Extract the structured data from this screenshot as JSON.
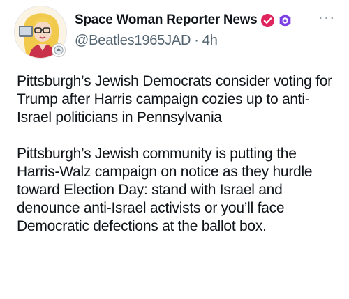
{
  "post": {
    "author": {
      "display_name": "Space Woman Reporter News",
      "handle": "@Beatles1965JAD",
      "avatar_icon": "avatar-cartoon-reporter",
      "verified_icon": "verified-check-icon",
      "badge_icon": "hexagon-badge-icon"
    },
    "time_separator": "·",
    "timestamp": "4h",
    "more_label": "···",
    "paragraphs": [
      "Pittsburgh’s Jewish Democrats consider voting for Trump after Harris campaign cozies up to anti-Israel politicians in Pennsylvania",
      "Pittsburgh’s Jewish community is putting the Harris-Walz campaign on notice as they hurdle toward Election Day: stand with Israel and denounce anti-Israel activists or you’ll face Democratic defections at the ballot box."
    ]
  },
  "colors": {
    "text_primary": "#0f1419",
    "text_secondary": "#536471",
    "verified_red": "#e0245e",
    "badge_purple": "#7b3fe4"
  }
}
